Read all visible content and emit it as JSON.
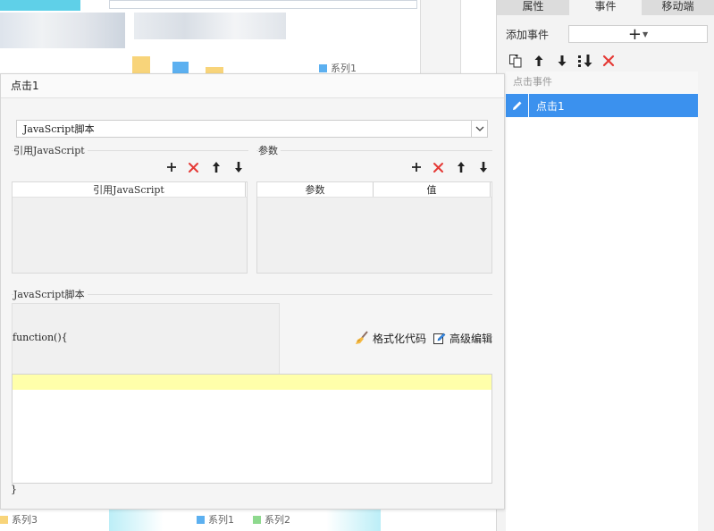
{
  "background": {
    "legend_top": "系列1",
    "legend_bottom": [
      "系列3",
      "系列1",
      "系列2"
    ],
    "colors": {
      "series1": "#5cb0f0",
      "series2": "#8ed98e",
      "series3": "#f8d47a"
    }
  },
  "right_panel": {
    "tabs": [
      {
        "label": "属性",
        "active": false
      },
      {
        "label": "事件",
        "active": true
      },
      {
        "label": "移动端",
        "active": false
      }
    ],
    "add_event_label": "添加事件",
    "add_event_button": "+",
    "toolbar_icons": [
      "copy-icon",
      "arrow-up-icon",
      "arrow-down-icon",
      "sort-down-icon",
      "delete-icon"
    ],
    "event_list": {
      "header": "点击事件",
      "items": [
        {
          "label": "点击1",
          "selected": true
        }
      ]
    }
  },
  "dialog": {
    "title": "点击1",
    "type_select": {
      "value": "JavaScript脚本"
    },
    "ref_js": {
      "title": "引用JavaScript",
      "columns": [
        "引用JavaScript"
      ]
    },
    "params": {
      "title": "参数",
      "columns": [
        "参数",
        "值"
      ]
    },
    "script": {
      "title": "JavaScript脚本",
      "fn_open": "function(){",
      "fn_close": "}",
      "format_code": "格式化代码",
      "advanced_edit": "高级编辑"
    }
  },
  "colors": {
    "accent": "#3b91ee",
    "delete": "#e53935",
    "highlight_line": "#ffffaa"
  }
}
